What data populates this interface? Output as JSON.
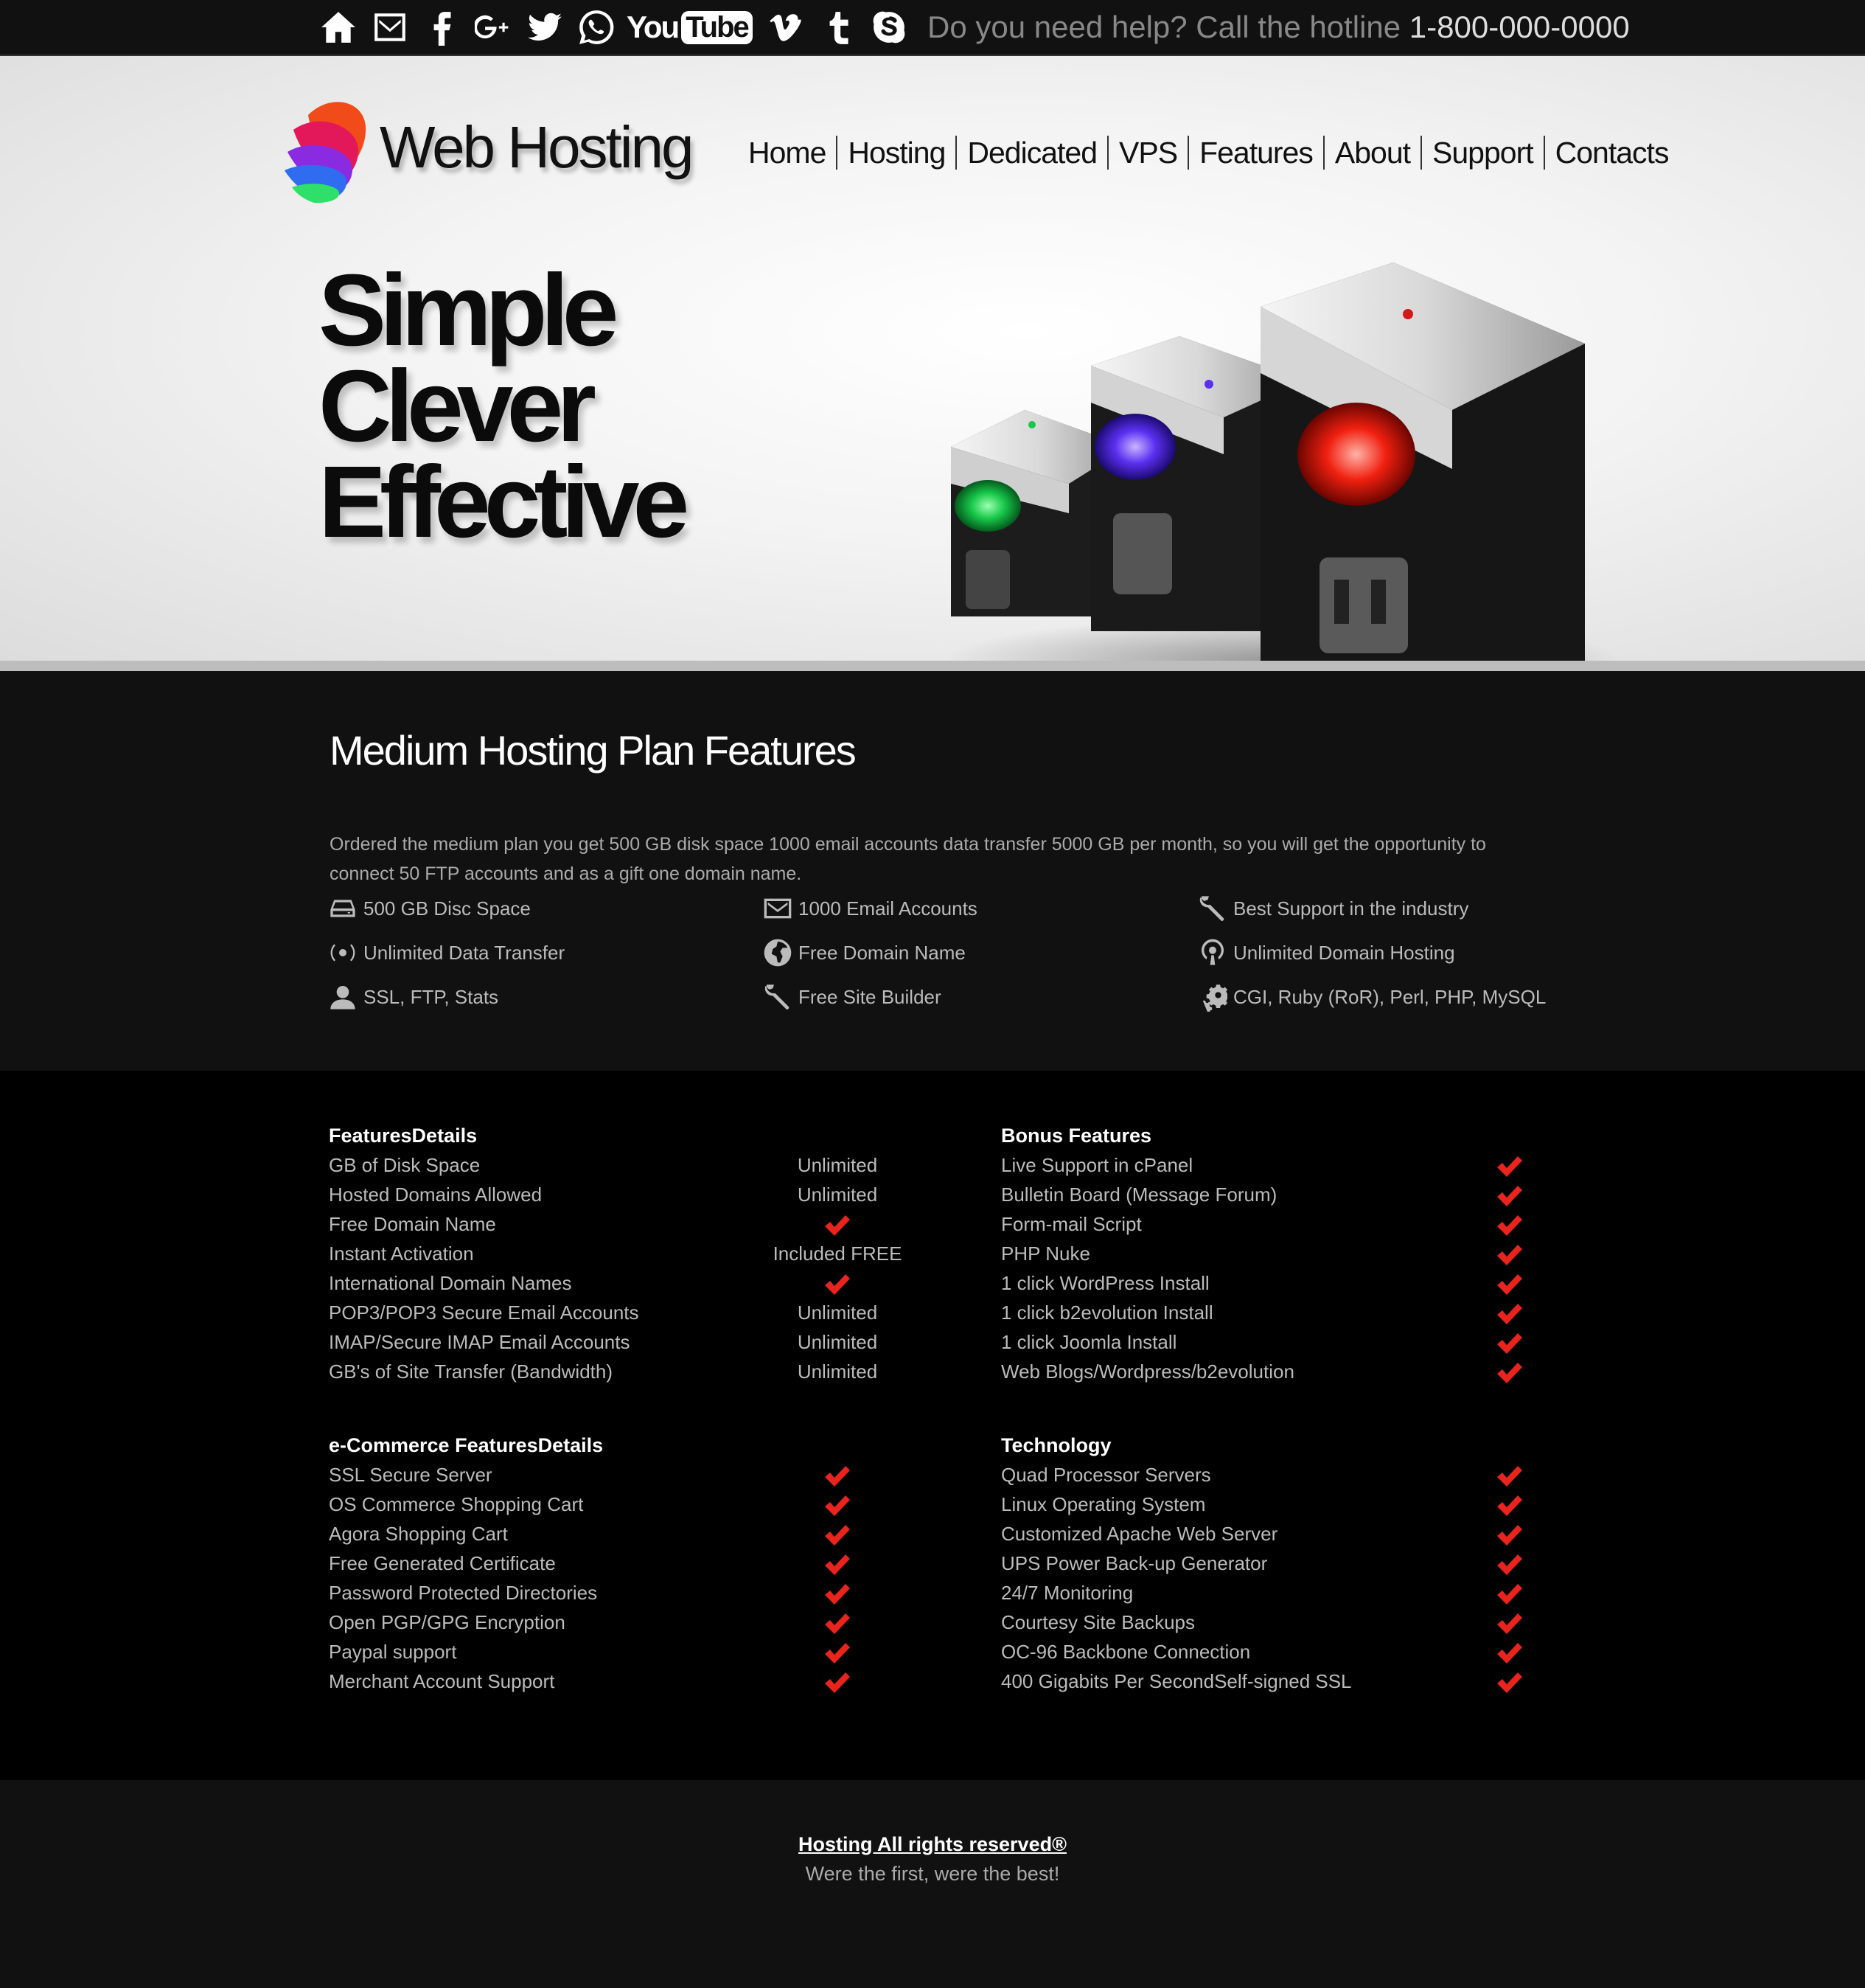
{
  "topbar": {
    "social": [
      "home-icon",
      "mail-icon",
      "facebook-icon",
      "google-plus-icon",
      "twitter-icon",
      "whatsapp-icon",
      "youtube-icon",
      "vimeo-icon",
      "tumblr-icon",
      "skype-icon"
    ],
    "youtube_you": "You",
    "youtube_tube": "Tube",
    "hotline_text": "Do you need help? Call the hotline",
    "hotline_number": "1-800-000-0000"
  },
  "header": {
    "brand": "Web Hosting",
    "nav": [
      "Home",
      "Hosting",
      "Dedicated",
      "VPS",
      "Features",
      "About",
      "Support",
      "Contacts"
    ],
    "tagline": [
      "Simple",
      "Clever",
      "Effective"
    ]
  },
  "features": {
    "title": "Medium Hosting Plan Features",
    "intro": "Ordered the medium plan you get 500 GB disk space 1000 email accounts data transfer 5000 GB per month, so you will get the opportunity to connect 50 FTP accounts and as a gift one domain name.",
    "items": [
      {
        "icon": "hard-drive-icon",
        "label": "500 GB Disc Space"
      },
      {
        "icon": "envelope-icon",
        "label": "1000 Email Accounts"
      },
      {
        "icon": "wrench-icon",
        "label": "Best Support in the industry"
      },
      {
        "icon": "broadcast-icon",
        "label": "Unlimited Data Transfer"
      },
      {
        "icon": "globe-icon",
        "label": "Free Domain Name"
      },
      {
        "icon": "podcast-icon",
        "label": "Unlimited Domain Hosting"
      },
      {
        "icon": "user-icon",
        "label": "SSL, FTP, Stats"
      },
      {
        "icon": "wrench-icon",
        "label": "Free Site Builder"
      },
      {
        "icon": "gears-icon",
        "label": "CGI, Ruby (RoR), Perl, PHP, MySQL"
      }
    ]
  },
  "details": {
    "features_details": {
      "title": "FeaturesDetails",
      "rows": [
        {
          "label": "GB of Disk Space",
          "value": "Unlimited"
        },
        {
          "label": "Hosted Domains Allowed",
          "value": "Unlimited"
        },
        {
          "label": "Free Domain Name",
          "value": "check"
        },
        {
          "label": "Instant Activation",
          "value": "Included FREE"
        },
        {
          "label": "International Domain Names",
          "value": "check"
        },
        {
          "label": "POP3/POP3 Secure Email Accounts",
          "value": "Unlimited"
        },
        {
          "label": "IMAP/Secure IMAP Email Accounts",
          "value": "Unlimited"
        },
        {
          "label": "GB's of Site Transfer (Bandwidth)",
          "value": "Unlimited"
        }
      ]
    },
    "bonus_features": {
      "title": "Bonus Features",
      "rows": [
        "Live Support in cPanel",
        "Bulletin Board (Message Forum)",
        "Form-mail Script",
        "PHP Nuke",
        "1 click WordPress Install",
        "1 click b2evolution Install",
        "1 click Joomla Install",
        "Web Blogs/Wordpress/b2evolution"
      ]
    },
    "ecommerce": {
      "title": "e-Commerce FeaturesDetails",
      "rows": [
        "SSL Secure Server",
        "OS Commerce Shopping Cart",
        "Agora Shopping Cart",
        "Free Generated Certificate",
        "Password Protected Directories",
        "Open PGP/GPG Encryption",
        "Paypal support",
        "Merchant Account Support"
      ]
    },
    "technology": {
      "title": "Technology",
      "rows": [
        "Quad Processor Servers",
        "Linux Operating System",
        "Customized Apache Web Server",
        "UPS Power Back-up Generator",
        "24/7 Monitoring",
        "Courtesy Site Backups",
        "OC-96 Backbone Connection",
        "400 Gigabits Per SecondSelf-signed SSL"
      ]
    }
  },
  "footer": {
    "copyright": "Hosting All rights reserved®",
    "slogan": "Were the first, were the best!"
  },
  "colors": {
    "check": "#e8241c",
    "accent": "#ffffff"
  }
}
